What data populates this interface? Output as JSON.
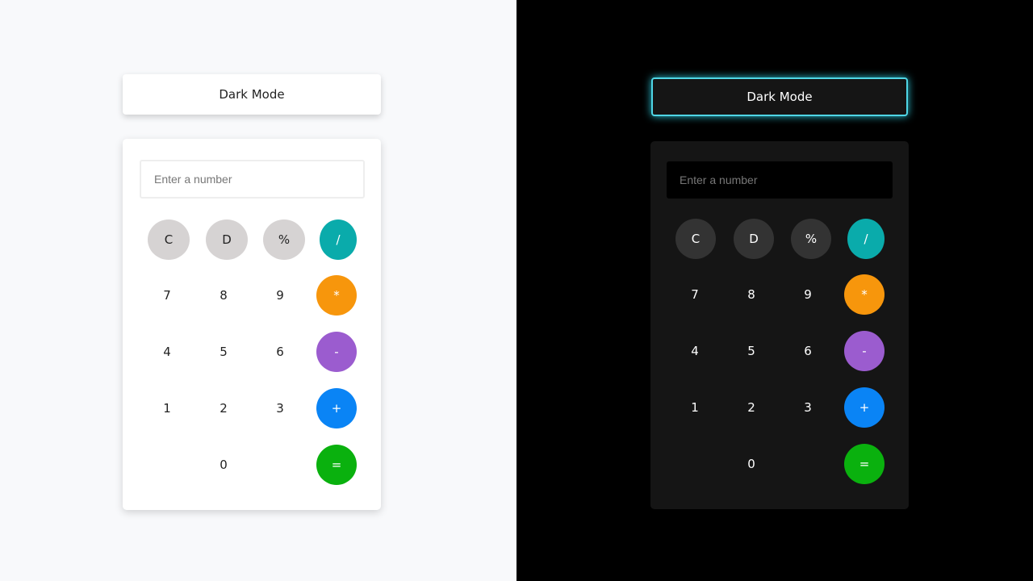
{
  "toggle_label": "Dark Mode",
  "input_placeholder": "Enter a number",
  "rows": [
    [
      {
        "label": "C",
        "kind": "gray"
      },
      {
        "label": "D",
        "kind": "gray"
      },
      {
        "label": "%",
        "kind": "gray"
      },
      {
        "label": "/",
        "kind": "op",
        "color": "#0aabab"
      }
    ],
    [
      {
        "label": "7"
      },
      {
        "label": "8"
      },
      {
        "label": "9"
      },
      {
        "label": "*",
        "kind": "op",
        "color": "#f7960c"
      }
    ],
    [
      {
        "label": "4"
      },
      {
        "label": "5"
      },
      {
        "label": "6"
      },
      {
        "label": "-",
        "kind": "op",
        "color": "#9b5ccf"
      }
    ],
    [
      {
        "label": "1"
      },
      {
        "label": "2"
      },
      {
        "label": "3"
      },
      {
        "label": "+",
        "kind": "op",
        "color": "#0a84f5"
      }
    ],
    [
      {
        "label": ""
      },
      {
        "label": "0"
      },
      {
        "label": ""
      },
      {
        "label": "=",
        "kind": "op",
        "color": "#0ab10e"
      }
    ]
  ],
  "themes": [
    "light",
    "dark"
  ]
}
